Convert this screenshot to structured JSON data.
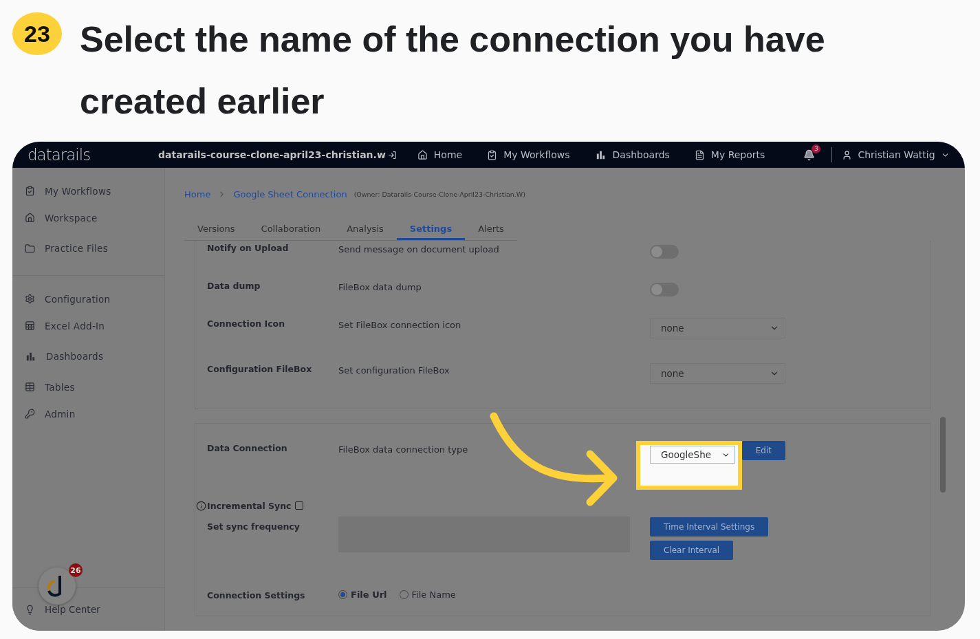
{
  "step": {
    "number": "23",
    "title": "Select the name of the connection you have created earlier"
  },
  "app": {
    "logo": "datarails",
    "workspace": "datarails-course-clone-april23-christian.w",
    "nav": [
      {
        "label": "Home"
      },
      {
        "label": "My Workflows"
      },
      {
        "label": "Dashboards"
      },
      {
        "label": "My Reports"
      }
    ],
    "notifications": "3",
    "user": "Christian Wattig"
  },
  "sidebar": {
    "groups": [
      [
        "My Workflows",
        "Workspace",
        "Practice Files"
      ],
      [
        "Configuration",
        "Excel Add-In",
        "Dashboards",
        "Tables",
        "Admin"
      ]
    ],
    "help": "Help Center",
    "chat_badge": "26"
  },
  "breadcrumb": {
    "items": [
      "Home",
      "Google Sheet Connection"
    ],
    "owner": "(Owner: Datarails-Course-Clone-April23-Christian.W)"
  },
  "tabs": [
    {
      "label": "Versions",
      "selected": false
    },
    {
      "label": "Collaboration",
      "selected": false
    },
    {
      "label": "Analysis",
      "selected": false
    },
    {
      "label": "Settings",
      "selected": true
    },
    {
      "label": "Alerts",
      "selected": false
    }
  ],
  "settings_panel": [
    {
      "kind": "toggle",
      "label": "Notify on Upload",
      "description": "Send message on document upload",
      "on": false
    },
    {
      "kind": "toggle",
      "label": "Data dump",
      "description": "FileBox data dump",
      "on": false
    },
    {
      "kind": "select",
      "label": "Connection Icon",
      "description": "Set FileBox connection icon",
      "value": "none"
    },
    {
      "kind": "select",
      "label": "Configuration FileBox",
      "description": "Set configuration FileBox",
      "value": "none"
    }
  ],
  "data_panel": {
    "data_connection": {
      "label": "Data Connection",
      "description": "FileBox data connection type",
      "value": "GoogleShe",
      "button": "Edit",
      "highlighted": true
    },
    "incremental_sync": {
      "label": "Incremental Sync",
      "checked": false
    },
    "sync_frequency": {
      "label": "Set sync frequency",
      "buttons": [
        "Time Interval Settings",
        "Clear Interval"
      ]
    },
    "connection_settings": {
      "label": "Connection Settings",
      "options": [
        {
          "label": "File Url",
          "selected": true
        },
        {
          "label": "File Name",
          "selected": false
        }
      ]
    }
  }
}
